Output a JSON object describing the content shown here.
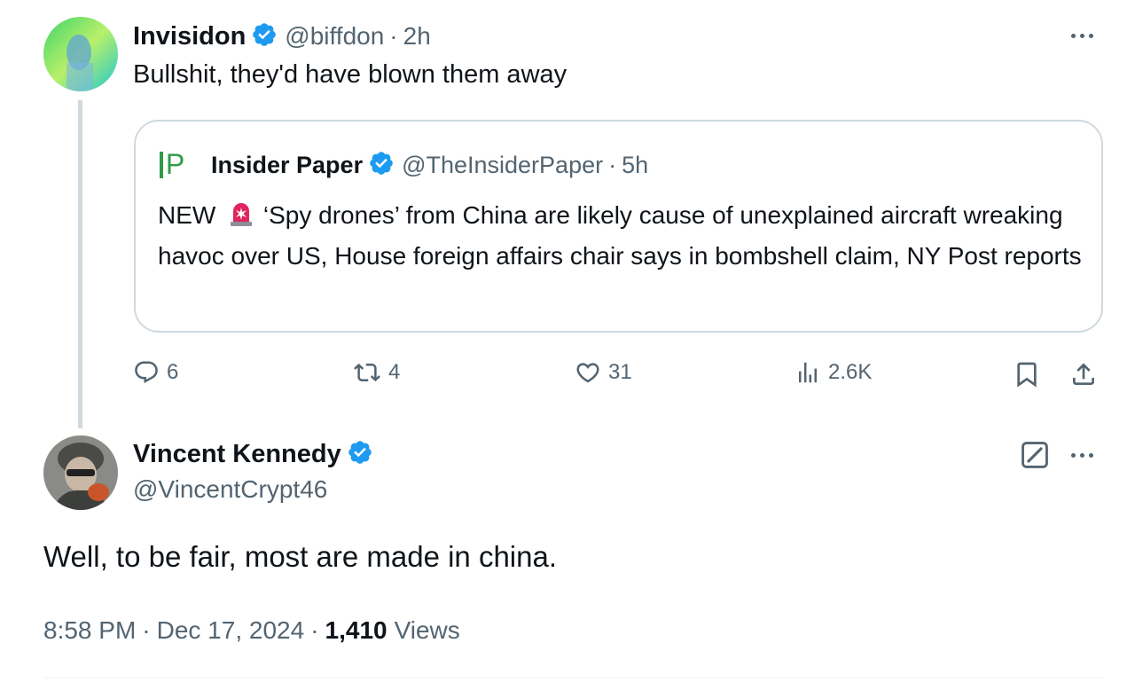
{
  "reply_tweet": {
    "author_name": "Invisidon",
    "handle": "@biffdon",
    "separator": "·",
    "time": "2h",
    "text": "Bullshit, they'd have blown them away",
    "quoted": {
      "logo_text": "IP",
      "author_name": "Insider Paper",
      "handle": "@TheInsiderPaper",
      "separator": "·",
      "time": "5h",
      "text_prefix": "NEW",
      "text_body": " ‘Spy drones’ from China are likely cause of unexplained aircraft wreaking havoc over US, House foreign affairs chair says in bombshell claim, NY Post reports"
    },
    "actions": {
      "replies": "6",
      "reposts": "4",
      "likes": "31",
      "views": "2.6K"
    }
  },
  "main_tweet": {
    "author_name": "Vincent Kennedy",
    "handle": "@VincentCrypt46",
    "text": "Well, to be fair, most are made in china.",
    "time": "8:58 PM",
    "date": "Dec 17, 2024",
    "separator": "·",
    "views_count": "1,410",
    "views_label": "Views"
  },
  "colors": {
    "verified": "#1d9bf0",
    "text": "#0f1419",
    "muted": "#536471",
    "border": "#cfd9de",
    "ip_logo": "#2e9b47",
    "siren": "#e0245e"
  },
  "icons": [
    "verified-badge-icon",
    "more-icon",
    "reply-icon",
    "repost-icon",
    "like-icon",
    "views-icon",
    "bookmark-icon",
    "share-icon",
    "grok-edit-icon",
    "siren-emoji-icon"
  ]
}
